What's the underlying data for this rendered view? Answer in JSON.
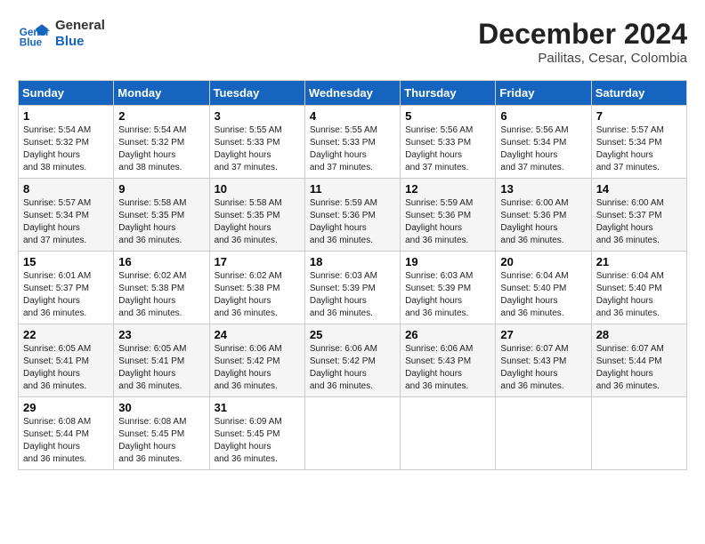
{
  "logo": {
    "line1": "General",
    "line2": "Blue"
  },
  "title": "December 2024",
  "location": "Pailitas, Cesar, Colombia",
  "days_of_week": [
    "Sunday",
    "Monday",
    "Tuesday",
    "Wednesday",
    "Thursday",
    "Friday",
    "Saturday"
  ],
  "weeks": [
    [
      {
        "day": "1",
        "sunrise": "5:54 AM",
        "sunset": "5:32 PM",
        "daylight": "11 hours and 38 minutes."
      },
      {
        "day": "2",
        "sunrise": "5:54 AM",
        "sunset": "5:32 PM",
        "daylight": "11 hours and 38 minutes."
      },
      {
        "day": "3",
        "sunrise": "5:55 AM",
        "sunset": "5:33 PM",
        "daylight": "11 hours and 37 minutes."
      },
      {
        "day": "4",
        "sunrise": "5:55 AM",
        "sunset": "5:33 PM",
        "daylight": "11 hours and 37 minutes."
      },
      {
        "day": "5",
        "sunrise": "5:56 AM",
        "sunset": "5:33 PM",
        "daylight": "11 hours and 37 minutes."
      },
      {
        "day": "6",
        "sunrise": "5:56 AM",
        "sunset": "5:34 PM",
        "daylight": "11 hours and 37 minutes."
      },
      {
        "day": "7",
        "sunrise": "5:57 AM",
        "sunset": "5:34 PM",
        "daylight": "11 hours and 37 minutes."
      }
    ],
    [
      {
        "day": "8",
        "sunrise": "5:57 AM",
        "sunset": "5:34 PM",
        "daylight": "11 hours and 37 minutes."
      },
      {
        "day": "9",
        "sunrise": "5:58 AM",
        "sunset": "5:35 PM",
        "daylight": "11 hours and 36 minutes."
      },
      {
        "day": "10",
        "sunrise": "5:58 AM",
        "sunset": "5:35 PM",
        "daylight": "11 hours and 36 minutes."
      },
      {
        "day": "11",
        "sunrise": "5:59 AM",
        "sunset": "5:36 PM",
        "daylight": "11 hours and 36 minutes."
      },
      {
        "day": "12",
        "sunrise": "5:59 AM",
        "sunset": "5:36 PM",
        "daylight": "11 hours and 36 minutes."
      },
      {
        "day": "13",
        "sunrise": "6:00 AM",
        "sunset": "5:36 PM",
        "daylight": "11 hours and 36 minutes."
      },
      {
        "day": "14",
        "sunrise": "6:00 AM",
        "sunset": "5:37 PM",
        "daylight": "11 hours and 36 minutes."
      }
    ],
    [
      {
        "day": "15",
        "sunrise": "6:01 AM",
        "sunset": "5:37 PM",
        "daylight": "11 hours and 36 minutes."
      },
      {
        "day": "16",
        "sunrise": "6:02 AM",
        "sunset": "5:38 PM",
        "daylight": "11 hours and 36 minutes."
      },
      {
        "day": "17",
        "sunrise": "6:02 AM",
        "sunset": "5:38 PM",
        "daylight": "11 hours and 36 minutes."
      },
      {
        "day": "18",
        "sunrise": "6:03 AM",
        "sunset": "5:39 PM",
        "daylight": "11 hours and 36 minutes."
      },
      {
        "day": "19",
        "sunrise": "6:03 AM",
        "sunset": "5:39 PM",
        "daylight": "11 hours and 36 minutes."
      },
      {
        "day": "20",
        "sunrise": "6:04 AM",
        "sunset": "5:40 PM",
        "daylight": "11 hours and 36 minutes."
      },
      {
        "day": "21",
        "sunrise": "6:04 AM",
        "sunset": "5:40 PM",
        "daylight": "11 hours and 36 minutes."
      }
    ],
    [
      {
        "day": "22",
        "sunrise": "6:05 AM",
        "sunset": "5:41 PM",
        "daylight": "11 hours and 36 minutes."
      },
      {
        "day": "23",
        "sunrise": "6:05 AM",
        "sunset": "5:41 PM",
        "daylight": "11 hours and 36 minutes."
      },
      {
        "day": "24",
        "sunrise": "6:06 AM",
        "sunset": "5:42 PM",
        "daylight": "11 hours and 36 minutes."
      },
      {
        "day": "25",
        "sunrise": "6:06 AM",
        "sunset": "5:42 PM",
        "daylight": "11 hours and 36 minutes."
      },
      {
        "day": "26",
        "sunrise": "6:06 AM",
        "sunset": "5:43 PM",
        "daylight": "11 hours and 36 minutes."
      },
      {
        "day": "27",
        "sunrise": "6:07 AM",
        "sunset": "5:43 PM",
        "daylight": "11 hours and 36 minutes."
      },
      {
        "day": "28",
        "sunrise": "6:07 AM",
        "sunset": "5:44 PM",
        "daylight": "11 hours and 36 minutes."
      }
    ],
    [
      {
        "day": "29",
        "sunrise": "6:08 AM",
        "sunset": "5:44 PM",
        "daylight": "11 hours and 36 minutes."
      },
      {
        "day": "30",
        "sunrise": "6:08 AM",
        "sunset": "5:45 PM",
        "daylight": "11 hours and 36 minutes."
      },
      {
        "day": "31",
        "sunrise": "6:09 AM",
        "sunset": "5:45 PM",
        "daylight": "11 hours and 36 minutes."
      },
      null,
      null,
      null,
      null
    ]
  ]
}
